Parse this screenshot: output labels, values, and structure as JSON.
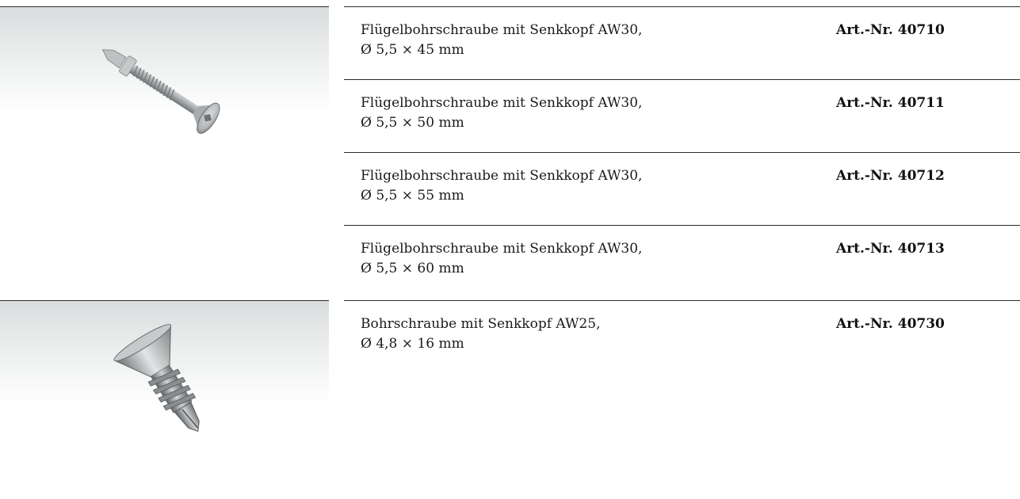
{
  "groups": [
    {
      "image_icon": "wing-drill-screw-countersunk-image",
      "items": [
        {
          "name": "Flügelbohrschraube mit Senkkopf AW30,",
          "size": "Ø 5,5 × 45 mm",
          "art_nr": "Art.-Nr. 40710"
        },
        {
          "name": "Flügelbohrschraube mit Senkkopf AW30,",
          "size": "Ø 5,5 × 50 mm",
          "art_nr": "Art.-Nr. 40711"
        },
        {
          "name": "Flügelbohrschraube mit Senkkopf AW30,",
          "size": "Ø 5,5 × 55 mm",
          "art_nr": "Art.-Nr. 40712"
        },
        {
          "name": "Flügelbohrschraube mit Senkkopf AW30,",
          "size": "Ø 5,5 × 60 mm",
          "art_nr": "Art.-Nr. 40713"
        }
      ]
    },
    {
      "image_icon": "drill-screw-countersunk-image",
      "items": [
        {
          "name": "Bohrschraube mit Senkkopf AW25,",
          "size": "Ø 4,8 × 16 mm",
          "art_nr": "Art.-Nr. 40730"
        }
      ]
    }
  ]
}
